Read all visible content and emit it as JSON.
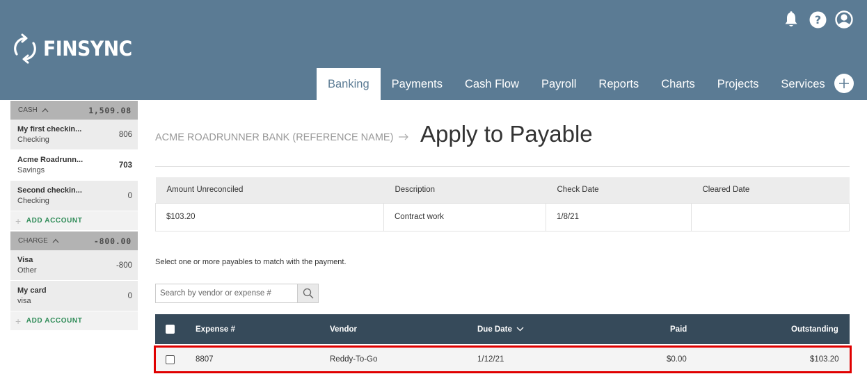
{
  "app": {
    "logo_text": "FINSYNC"
  },
  "header": {
    "icons": [
      "bell-icon",
      "help-icon",
      "user-icon"
    ],
    "nav": [
      {
        "label": "Banking",
        "active": true
      },
      {
        "label": "Payments"
      },
      {
        "label": "Cash Flow"
      },
      {
        "label": "Payroll"
      },
      {
        "label": "Reports"
      },
      {
        "label": "Charts"
      },
      {
        "label": "Projects"
      },
      {
        "label": "Services"
      }
    ]
  },
  "sidebar": {
    "cash": {
      "label": "CASH",
      "total": "1,509.08",
      "accounts": [
        {
          "name": "My first checkin...",
          "type": "Checking",
          "value": "806"
        },
        {
          "name": "Acme Roadrunn...",
          "type": "Savings",
          "value": "703",
          "selected": true
        },
        {
          "name": "Second checkin...",
          "type": "Checking",
          "value": "0"
        }
      ],
      "add_label": "ADD ACCOUNT"
    },
    "charge": {
      "label": "CHARGE",
      "total": "-800.00",
      "accounts": [
        {
          "name": "Visa",
          "type": "Other",
          "value": "-800"
        },
        {
          "name": "My card",
          "type": "visa",
          "value": "0"
        }
      ],
      "add_label": "ADD ACCOUNT"
    }
  },
  "main": {
    "breadcrumb": "ACME ROADRUNNER BANK (REFERENCE NAME)",
    "title": "Apply to Payable",
    "info": {
      "headers": [
        "Amount Unreconciled",
        "Description",
        "Check Date",
        "Cleared Date"
      ],
      "row": [
        "$103.20",
        "Contract work",
        "1/8/21",
        ""
      ]
    },
    "instruction": "Select one or more payables to match with the payment.",
    "search": {
      "placeholder": "Search by vendor or expense #"
    },
    "expenses": {
      "headers": {
        "expense": "Expense #",
        "vendor": "Vendor",
        "due_date": "Due Date",
        "paid": "Paid",
        "outstanding": "Outstanding"
      },
      "rows": [
        {
          "expense": "8807",
          "vendor": "Reddy-To-Go",
          "due_date": "1/12/21",
          "paid": "$0.00",
          "outstanding": "$103.20"
        }
      ]
    }
  },
  "colors": {
    "header_bg": "#5b7b94",
    "table_head_bg": "#364a5a",
    "accent_green": "#2e8b57",
    "highlight": "#e00000"
  }
}
